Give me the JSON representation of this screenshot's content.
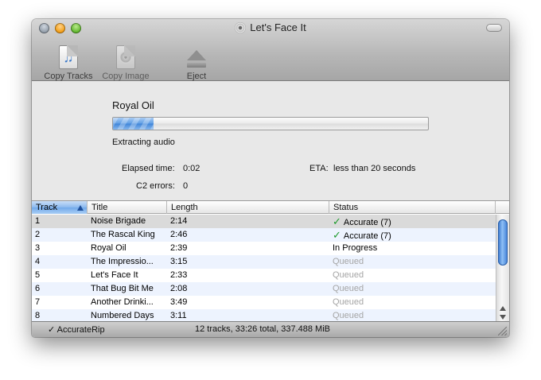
{
  "window": {
    "title": "Let's Face It"
  },
  "toolbar": {
    "copy_tracks": "Copy Tracks",
    "copy_image": "Copy Image",
    "eject": "Eject"
  },
  "progress": {
    "track_title": "Royal Oil",
    "fraction": 0.13,
    "status": "Extracting audio",
    "elapsed_label": "Elapsed time:",
    "elapsed_value": "0:02",
    "eta_label": "ETA:",
    "eta_value": "less than 20 seconds",
    "c2_label": "C2 errors:",
    "c2_value": "0"
  },
  "table": {
    "columns": {
      "track": "Track",
      "title": "Title",
      "length": "Length",
      "status": "Status"
    },
    "rows": [
      {
        "track": "1",
        "title": "Noise Brigade",
        "length": "2:14",
        "status": "Accurate (7)",
        "state": "accurate"
      },
      {
        "track": "2",
        "title": "The Rascal King",
        "length": "2:46",
        "status": "Accurate (7)",
        "state": "accurate"
      },
      {
        "track": "3",
        "title": "Royal Oil",
        "length": "2:39",
        "status": "In Progress",
        "state": "progress"
      },
      {
        "track": "4",
        "title": "The Impressio...",
        "length": "3:15",
        "status": "Queued",
        "state": "queued"
      },
      {
        "track": "5",
        "title": "Let's Face It",
        "length": "2:33",
        "status": "Queued",
        "state": "queued"
      },
      {
        "track": "6",
        "title": "That Bug Bit Me",
        "length": "2:08",
        "status": "Queued",
        "state": "queued"
      },
      {
        "track": "7",
        "title": "Another Drinki...",
        "length": "3:49",
        "status": "Queued",
        "state": "queued"
      },
      {
        "track": "8",
        "title": "Numbered Days",
        "length": "3:11",
        "status": "Queued",
        "state": "queued"
      }
    ]
  },
  "statusbar": {
    "accuraterip": "✓ AccurateRip",
    "summary": "12 tracks, 33:26 total, 337.488 MiB"
  },
  "icons": {
    "copy_tracks": "music-document-icon",
    "copy_image": "disc-document-icon",
    "eject": "eject-icon",
    "accurate": "checkmark-icon"
  },
  "colors": {
    "accent": "#5f9de4",
    "check": "#1d9a2c",
    "queued": "#a5a5a5"
  }
}
